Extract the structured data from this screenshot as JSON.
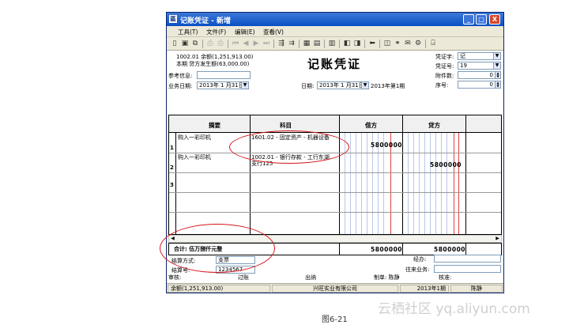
{
  "window": {
    "title": "记账凭证 - 新增",
    "icon_glyph": "區"
  },
  "title_buttons": {
    "minimize": "_",
    "maximize": "□",
    "close": "X"
  },
  "menu": [
    "工具(T)",
    "文件(F)",
    "编辑(E)",
    "查看(V)"
  ],
  "toolbar_icons": [
    "new-icon",
    "save-icon",
    "copy-icon",
    "print-preview-icon",
    "print-icon",
    "first-icon",
    "prev-icon",
    "next-icon",
    "last-icon",
    "insert-row-icon",
    "delete-row-icon",
    "calculator-icon",
    "report-icon",
    "grid-icon",
    "book-icon",
    "view-icon",
    "back-icon",
    "attach-icon",
    "link-icon",
    "mail-icon",
    "settings-icon",
    "exit-icon"
  ],
  "header": {
    "account_code_line": "1002.01   余额(1,251,913.00)",
    "period_line": "本期  贷方发生额(63,000.00)",
    "doc_title": "记账凭证",
    "ref_label": "参考信息:",
    "biz_date_label": "业务日期:",
    "biz_date_value": "2013年 1 月31日",
    "date_label": "日期:",
    "date_value": "2013年 1 月31日",
    "period_value": "2013年第1期",
    "voucher_word_label": "凭证字:",
    "voucher_word_value": "记",
    "voucher_no_label": "凭证号:",
    "voucher_no_value": "19",
    "attachments_label": "附件数:",
    "attachments_value": "0",
    "seq_label": "序号:",
    "seq_value": "0"
  },
  "columns": {
    "summary": "摘要",
    "subject": "科目",
    "debit": "借方",
    "credit": "贷方"
  },
  "rows": [
    {
      "num": "1",
      "summary": "购入一彩印机",
      "subject_line1": "1601.02 - 固定资产 - 机器设备",
      "subject_line2": "",
      "debit": "5800000",
      "credit": ""
    },
    {
      "num": "2",
      "summary": "购入一彩印机",
      "subject_line1": "1002.01 - 银行存款 - 工行东湖",
      "subject_line2": "支行125",
      "debit": "",
      "credit": "5800000"
    },
    {
      "num": "3",
      "summary": "",
      "subject_line1": "",
      "subject_line2": "",
      "debit": "",
      "credit": ""
    }
  ],
  "total": {
    "label": "合计: 伍万捌仟元整",
    "debit": "5800000",
    "credit": "5800000"
  },
  "settlement": {
    "method_label": "结算方式:",
    "method_value": "支票",
    "number_label": "结算号:",
    "number_value": "1234567",
    "handler_label": "经办:",
    "counterparty_label": "往来业务:"
  },
  "signatures": {
    "audit": "审核:",
    "posting": "过账",
    "cashier": "出纳",
    "maker": "制单: 陈静",
    "checker": "核准:"
  },
  "status": {
    "balance": "余额(1,251,913.00)",
    "company": "兴旺实业有限公司",
    "period": "2013年1期",
    "user": "陈静"
  },
  "caption": "图6-21",
  "watermark": "云栖社区 yq.aliyun.com",
  "colors": {
    "title_bar": "#0a4fc4",
    "annotation": "#d4141a",
    "red_rule": "#e04040"
  }
}
